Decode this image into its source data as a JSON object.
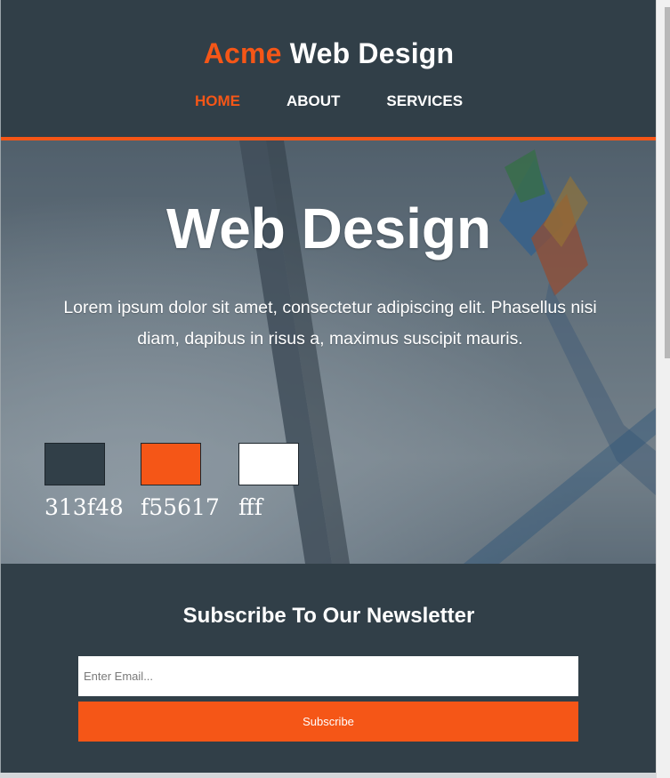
{
  "header": {
    "brand_accent": "Acme",
    "brand_rest": "Web Design",
    "nav": [
      {
        "label": "HOME",
        "active": true
      },
      {
        "label": "ABOUT",
        "active": false
      },
      {
        "label": "SERVICES",
        "active": false
      }
    ]
  },
  "hero": {
    "title": "Web Design",
    "text": "Lorem ipsum dolor sit amet, consectetur adipiscing elit. Phasellus nisi diam, dapibus in risus a, maximus suscipit mauris."
  },
  "swatches": [
    {
      "label": "313f48",
      "color": "#313f48"
    },
    {
      "label": "f55617",
      "color": "#f55617"
    },
    {
      "label": "fff",
      "color": "#ffffff"
    }
  ],
  "newsletter": {
    "title": "Subscribe To Our Newsletter",
    "email_placeholder": "Enter Email...",
    "button_label": "Subscribe"
  },
  "colors": {
    "primary": "#313f48",
    "accent": "#f55617",
    "light": "#ffffff"
  }
}
